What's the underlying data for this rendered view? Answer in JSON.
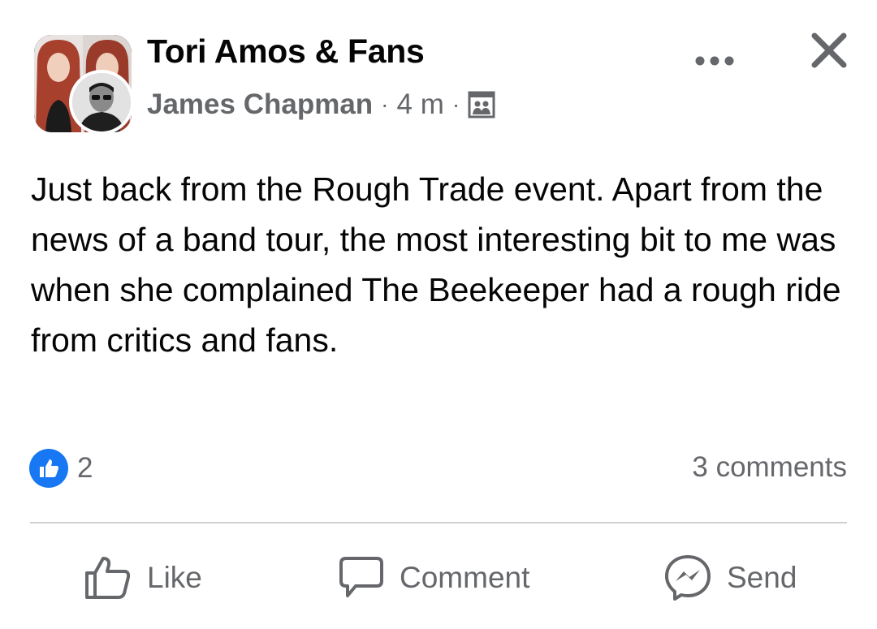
{
  "post": {
    "group_name": "Tori Amos & Fans",
    "author": "James Chapman",
    "time": "4 m",
    "separator": "·",
    "audience_icon": "group-audience-icon",
    "body": "Just back from the Rough Trade event. Apart from the news of a band tour, the most interesting bit to me was when she complained The Beekeeper had a rough ride from critics and fans."
  },
  "engagement": {
    "reaction_icon": "like-icon",
    "reaction_count": "2",
    "comments": "3 comments"
  },
  "actions": {
    "like_label": "Like",
    "comment_label": "Comment",
    "send_label": "Send"
  },
  "colors": {
    "brand_blue": "#1877f2",
    "secondary_text": "#65676b",
    "divider": "#ced0d4",
    "top_strip": "#c9ccd1"
  }
}
